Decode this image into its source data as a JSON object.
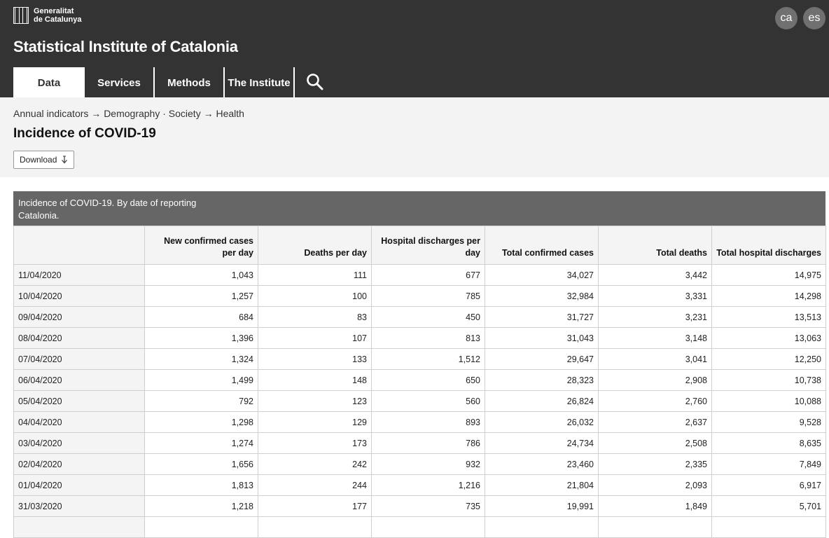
{
  "header": {
    "logo_line1": "Generalitat",
    "logo_line2": "de Catalunya",
    "site_title": "Statistical Institute of Catalonia",
    "languages": [
      "ca",
      "es"
    ],
    "nav": [
      {
        "label": "Data",
        "active": true
      },
      {
        "label": "Services",
        "active": false
      },
      {
        "label": "Methods",
        "active": false
      },
      {
        "label": "The Institute",
        "active": false
      }
    ],
    "search_icon": "search-icon"
  },
  "breadcrumb": {
    "level1": "Annual indicators",
    "sep1": "→",
    "level2": "Demography · Society",
    "sep2": "→",
    "level3": "Health"
  },
  "page_title": "Incidence of COVID-19",
  "download_label": "Download",
  "table": {
    "caption_line1": "Incidence of COVID-19. By date of reporting",
    "caption_line2": "Catalonia.",
    "columns": [
      "New confirmed cases per day",
      "Deaths per day",
      "Hospital discharges per day",
      "Total confirmed cases",
      "Total deaths",
      "Total hospital discharges"
    ],
    "rows": [
      {
        "date": "11/04/2020",
        "values": [
          "1,043",
          "111",
          "677",
          "34,027",
          "3,442",
          "14,975"
        ]
      },
      {
        "date": "10/04/2020",
        "values": [
          "1,257",
          "100",
          "785",
          "32,984",
          "3,331",
          "14,298"
        ]
      },
      {
        "date": "09/04/2020",
        "values": [
          "684",
          "83",
          "450",
          "31,727",
          "3,231",
          "13,513"
        ]
      },
      {
        "date": "08/04/2020",
        "values": [
          "1,396",
          "107",
          "813",
          "31,043",
          "3,148",
          "13,063"
        ]
      },
      {
        "date": "07/04/2020",
        "values": [
          "1,324",
          "133",
          "1,512",
          "29,647",
          "3,041",
          "12,250"
        ]
      },
      {
        "date": "06/04/2020",
        "values": [
          "1,499",
          "148",
          "650",
          "28,323",
          "2,908",
          "10,738"
        ]
      },
      {
        "date": "05/04/2020",
        "values": [
          "792",
          "123",
          "560",
          "26,824",
          "2,760",
          "10,088"
        ]
      },
      {
        "date": "04/04/2020",
        "values": [
          "1,298",
          "129",
          "893",
          "26,032",
          "2,637",
          "9,528"
        ]
      },
      {
        "date": "03/04/2020",
        "values": [
          "1,274",
          "173",
          "786",
          "24,734",
          "2,508",
          "8,635"
        ]
      },
      {
        "date": "02/04/2020",
        "values": [
          "1,656",
          "242",
          "932",
          "23,460",
          "2,335",
          "7,849"
        ]
      },
      {
        "date": "01/04/2020",
        "values": [
          "1,813",
          "244",
          "1,216",
          "21,804",
          "2,093",
          "6,917"
        ]
      },
      {
        "date": "31/03/2020",
        "values": [
          "1,218",
          "177",
          "735",
          "19,991",
          "1,849",
          "5,701"
        ]
      },
      {
        "date": "",
        "values": [
          "",
          "",
          "",
          "",
          "",
          ""
        ]
      }
    ]
  }
}
